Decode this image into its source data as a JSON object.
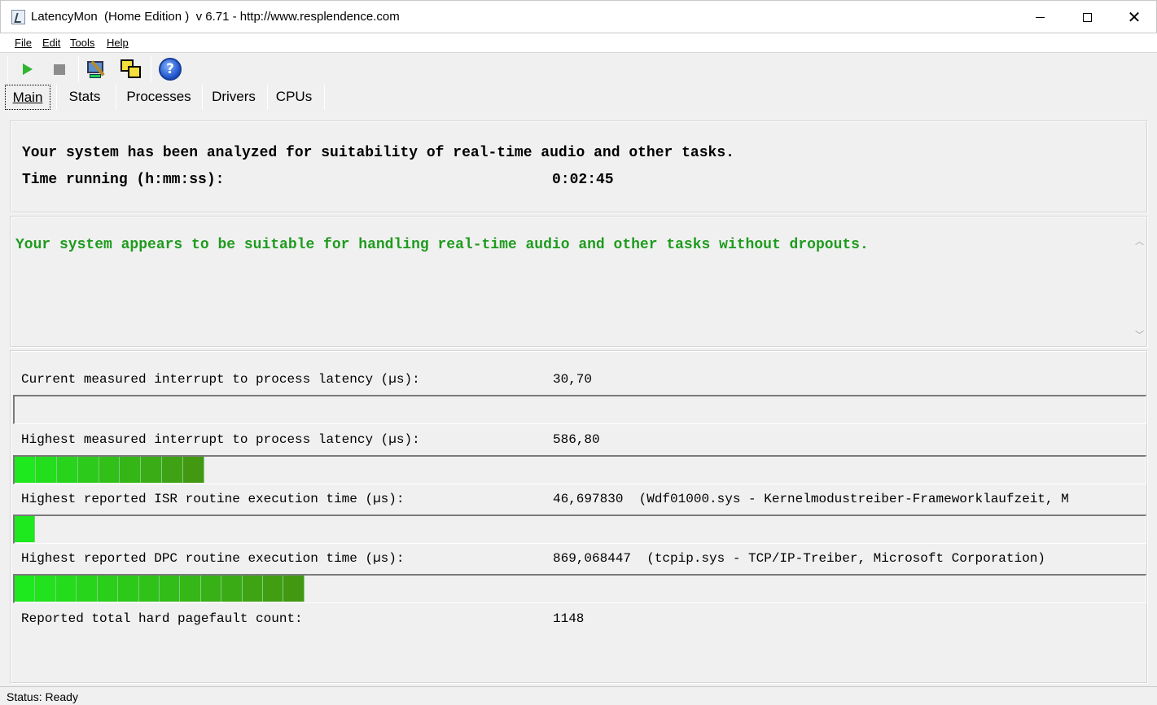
{
  "window": {
    "title": "LatencyMon  (Home Edition )  v 6.71 - http://www.resplendence.com",
    "minimize_icon": "minimize-icon",
    "maximize_icon": "maximize-icon",
    "close_icon": "close-icon"
  },
  "menu": {
    "file": "File",
    "edit": "Edit",
    "tools": "Tools",
    "help": "Help"
  },
  "toolbar": {
    "start_icon": "play-icon",
    "stop_icon": "stop-icon",
    "monitor_icon": "system-monitor-icon",
    "windows_icon": "windows-icon",
    "help_icon": "help-icon"
  },
  "tabs": {
    "main": "Main",
    "stats": "Stats",
    "processes": "Processes",
    "drivers": "Drivers",
    "cpus": "CPUs",
    "active": "Main"
  },
  "summary": {
    "analyzed_text": "Your system has been analyzed for suitability of real-time audio and other tasks.",
    "time_label": "Time running (h:mm:ss):",
    "time_value": "0:02:45"
  },
  "verdict": {
    "text": "Your system appears to be suitable for handling real-time audio and other tasks without dropouts.",
    "color": "#1e9b1e"
  },
  "metrics": {
    "current_latency": {
      "label": "Current measured interrupt to process latency (µs):",
      "value": "30,70",
      "level_fraction": 0.0
    },
    "highest_latency": {
      "label": "Highest measured interrupt to process latency (µs):",
      "value": "586,80",
      "level_fraction": 0.168
    },
    "highest_isr": {
      "label": "Highest reported ISR routine execution time (µs):",
      "value": "46,697830",
      "detail": "(Wdf01000.sys - Kernelmodustreiber-Frameworklaufzeit, M",
      "level_fraction": 0.018
    },
    "highest_dpc": {
      "label": "Highest reported DPC routine execution time (µs):",
      "value": "869,068447",
      "detail": "(tcpip.sys - TCP/IP-Treiber, Microsoft Corporation)",
      "level_fraction": 0.256
    },
    "pagefault": {
      "label": "Reported total hard pagefault count:",
      "value": "1148"
    }
  },
  "bar_colors": {
    "bright": "#1ee81e",
    "dark": "#4a8a10"
  },
  "status": {
    "text": "Status: Ready"
  }
}
